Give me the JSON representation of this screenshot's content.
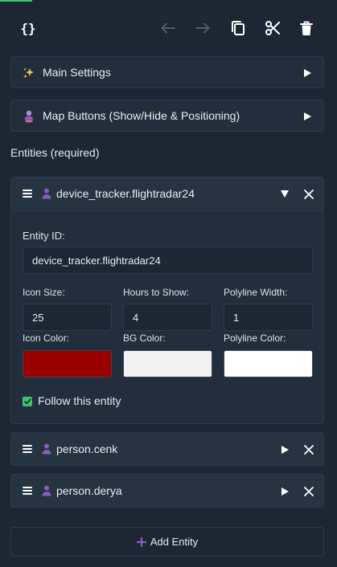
{
  "toolbar": {
    "code_label": "{}",
    "icons": [
      "braces-icon",
      "arrow-left-icon",
      "arrow-right-icon",
      "copy-icon",
      "scissors-icon",
      "trash-icon"
    ]
  },
  "sections": {
    "main_settings": {
      "title": "Main Settings",
      "icon": "sparkles-icon"
    },
    "map_buttons": {
      "title": "Map Buttons (Show/Hide & Positioning)",
      "icon": "person-pin-icon"
    }
  },
  "entities_label": "Entities (required)",
  "expanded_entity": {
    "name": "device_tracker.flightradar24",
    "entity_id_label": "Entity ID:",
    "entity_id_value": "device_tracker.flightradar24",
    "icon_size_label": "Icon Size:",
    "icon_size_value": "25",
    "hours_label": "Hours to Show:",
    "hours_value": "4",
    "polyline_width_label": "Polyline Width:",
    "polyline_width_value": "1",
    "icon_color_label": "Icon Color:",
    "bg_color_label": "BG Color:",
    "polyline_color_label": "Polyline Color:",
    "follow_label": "Follow this entity",
    "follow_checked": true
  },
  "colors": {
    "icon_color": "#9b0000",
    "bg_color": "#f2f2f2",
    "polyline_color": "#ffffff",
    "accent": "#3ec46d",
    "person_icon": "#8a5cc4"
  },
  "entities": [
    {
      "name": "person.cenk"
    },
    {
      "name": "person.derya"
    }
  ],
  "add_entity_label": "Add Entity"
}
